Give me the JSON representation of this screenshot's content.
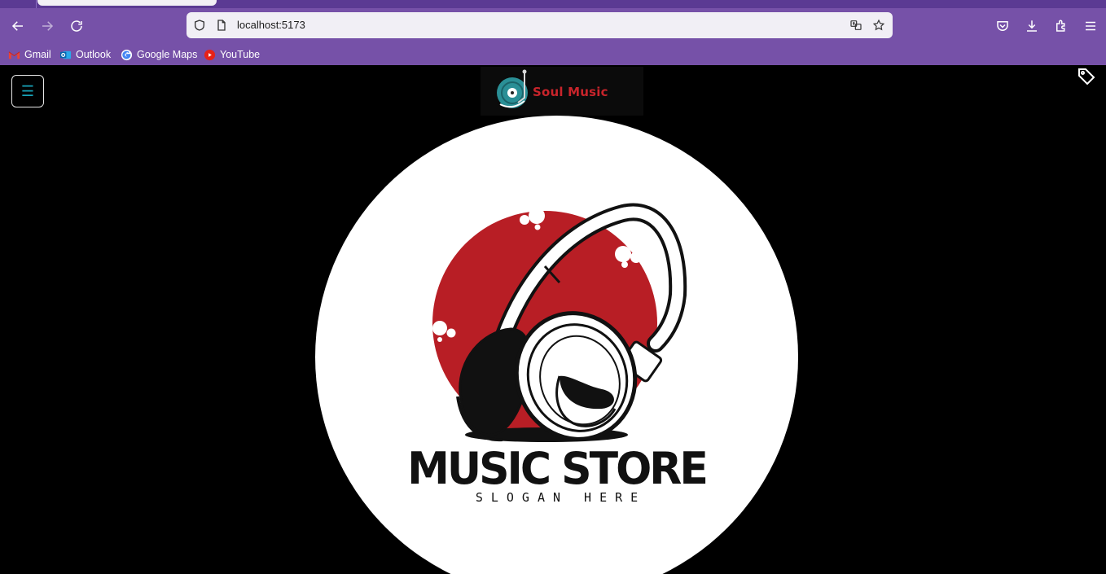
{
  "browser": {
    "url": "localhost:5173",
    "bookmarks": [
      {
        "label": "Gmail",
        "icon": "gmail-icon"
      },
      {
        "label": "Outlook",
        "icon": "outlook-icon"
      },
      {
        "label": "Google Maps",
        "icon": "google-icon"
      },
      {
        "label": "YouTube",
        "icon": "youtube-icon"
      }
    ]
  },
  "page": {
    "brand": {
      "name": "Soul Music"
    },
    "hero": {
      "title": "MUSIC STORE",
      "slogan": "SLOGAN HERE"
    },
    "colors": {
      "accent_red": "#c8242b",
      "teal": "#2a8f96",
      "menu_icon": "#17a2b8",
      "chrome_purple": "#7651a8"
    }
  }
}
